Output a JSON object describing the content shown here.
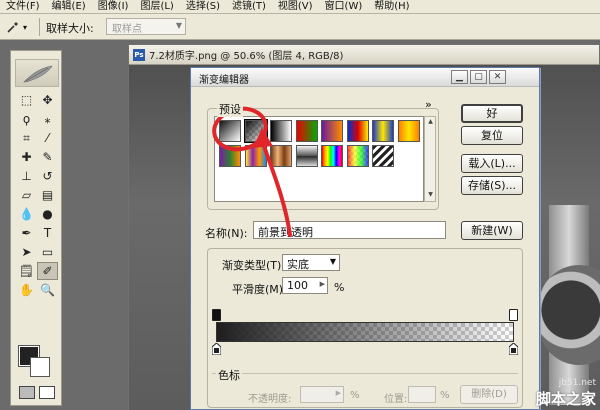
{
  "menu": [
    "文件(F)",
    "编辑(E)",
    "图像(I)",
    "图层(L)",
    "选择(S)",
    "滤镜(T)",
    "视图(V)",
    "窗口(W)",
    "帮助(H)"
  ],
  "options_bar": {
    "tool_icon": "eyedropper-icon",
    "sample_size_label": "取样大小:",
    "sample_size_value": "取样点"
  },
  "document": {
    "title": "7.2材质字.png @ 50.6% (图层 4, RGB/8)"
  },
  "dialog": {
    "title": "渐变编辑器",
    "presets_label": "预设",
    "presets_more": "»",
    "presets": {
      "row1": [
        "fg-to-bg",
        "fg-to-transparent",
        "black-white",
        "red-green",
        "violet-orange",
        "blue-red-yellow",
        "blue-yellow-blue",
        "orange-yellow-orange"
      ],
      "row2": [
        "violet-green-orange",
        "yellow-violet-orange-blue",
        "copper",
        "chrome",
        "spectrum",
        "transparent-rainbow",
        "transparent-stripes"
      ]
    },
    "buttons": {
      "ok": "好",
      "reset": "复位",
      "load": "载入(L)...",
      "save": "存储(S)...",
      "new": "新建(W)"
    },
    "name_label": "名称(N):",
    "name_value": "前景到透明",
    "gradient_type_label": "渐变类型(T):",
    "gradient_type_value": "实底",
    "smoothness_label": "平滑度(M):",
    "smoothness_value": "100",
    "smoothness_unit": "%",
    "stops_label": "色标",
    "opacity_label": "不透明度:",
    "opacity_unit": "%",
    "location_label": "位置:",
    "location_unit": "%",
    "delete_label": "删除(D)"
  },
  "annotation_colors": {
    "circle": "#e0262b",
    "arrow": "#e0262b"
  },
  "watermark": {
    "url": "jb51.net",
    "brand": "脚本之家"
  }
}
